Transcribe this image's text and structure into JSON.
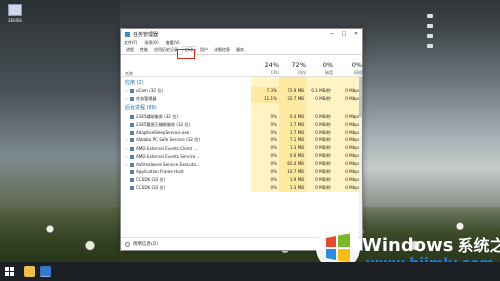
{
  "desktop": {
    "icon_label": "360ISS"
  },
  "window": {
    "title": "任务管理器",
    "menu": [
      "文件(F)",
      "选项(O)",
      "查看(V)"
    ],
    "tabs": [
      "进程",
      "性能",
      "应用历史记录",
      "启动",
      "用户",
      "详细信息",
      "服务"
    ],
    "selected_tab_index": 3,
    "header": {
      "name": "名称",
      "cpu": {
        "pct": "24%",
        "label": "CPU"
      },
      "mem": {
        "pct": "72%",
        "label": "内存"
      },
      "disk": {
        "pct": "0%",
        "label": "磁盘"
      },
      "net": {
        "pct": "0%",
        "label": "网络"
      }
    },
    "groups": [
      {
        "label": "应用 (2)",
        "rows": [
          {
            "name": "oCam (32 位)",
            "cpu": "7.3%",
            "mem": "72.9 MB",
            "disk": "0.1 MB/秒",
            "net": "0 Mbps"
          },
          {
            "name": "任务管理器",
            "cpu": "11.1%",
            "mem": "32.7 MB",
            "disk": "0 MB/秒",
            "net": "0 Mbps"
          }
        ]
      },
      {
        "label": "后台进程 (88)",
        "rows": [
          {
            "name": "2345辅助服务 (32 位)",
            "cpu": "0%",
            "mem": "0.4 MB",
            "disk": "0 MB/秒",
            "net": "0 Mbps"
          },
          {
            "name": "2345看图王辅助服务 (32 位)",
            "cpu": "0%",
            "mem": "1.7 MB",
            "disk": "0 MB/秒",
            "net": "0 Mbps"
          },
          {
            "name": "AdaptiveSleepService.exe",
            "cpu": "0%",
            "mem": "1.7 MB",
            "disk": "0 MB/秒",
            "net": "0 Mbps"
          },
          {
            "name": "Alibaba PC Safe Service (32 位)",
            "cpu": "0%",
            "mem": "7.1 MB",
            "disk": "0 MB/秒",
            "net": "0 Mbps"
          },
          {
            "name": "AMD External Events Client ...",
            "cpu": "0%",
            "mem": "1.3 MB",
            "disk": "0 MB/秒",
            "net": "0 Mbps"
          },
          {
            "name": "AMD External Events Service ...",
            "cpu": "0%",
            "mem": "0.6 MB",
            "disk": "0 MB/秒",
            "net": "0 Mbps"
          },
          {
            "name": "Antimalware Service Executa...",
            "cpu": "0%",
            "mem": "82.4 MB",
            "disk": "0 MB/秒",
            "net": "0 Mbps"
          },
          {
            "name": "Application Frame Host",
            "cpu": "0%",
            "mem": "10.7 MB",
            "disk": "0 MB/秒",
            "net": "0 Mbps"
          },
          {
            "name": "CCSDK (32 位)",
            "cpu": "0%",
            "mem": "1.9 MB",
            "disk": "0 MB/秒",
            "net": "0 Mbps"
          },
          {
            "name": "CCSDK (32 位)",
            "cpu": "0%",
            "mem": "1.3 MB",
            "disk": "0 MB/秒",
            "net": "0 Mbps"
          }
        ]
      }
    ],
    "footer_label": "简略信息(D)"
  },
  "watermark": {
    "windows": "Windows",
    "cn": "系统之家",
    "url": "www.bjjmlv.com"
  }
}
